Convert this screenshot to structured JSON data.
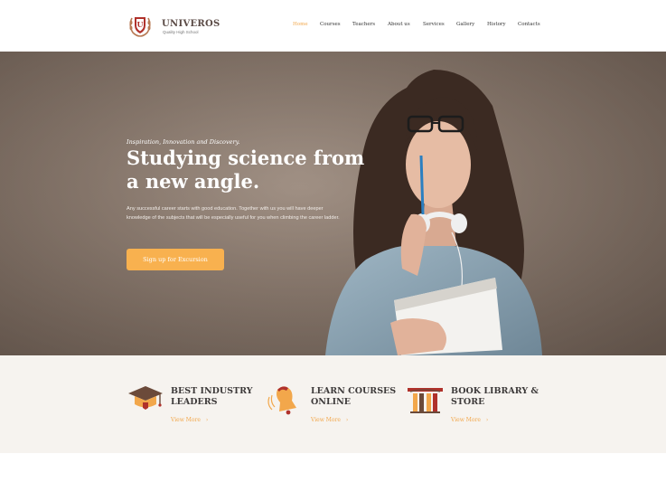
{
  "brand": {
    "name": "UNIVEROS",
    "tagline": "Quality High School"
  },
  "nav": {
    "items": [
      {
        "label": "Home",
        "active": true
      },
      {
        "label": "Courses",
        "active": false
      },
      {
        "label": "Teachers",
        "active": false
      },
      {
        "label": "About us",
        "active": false
      },
      {
        "label": "Services",
        "active": false
      },
      {
        "label": "Gallery",
        "active": false
      },
      {
        "label": "History",
        "active": false
      },
      {
        "label": "Contacts",
        "active": false
      }
    ]
  },
  "hero": {
    "kicker": "Inspiration, Innovation and Discovery.",
    "title": "Studying science from a new angle.",
    "text": "Any successful career starts with good education. Together with us you will have deeper knowledge of the subjects that will be especially useful for you when climbing the career ladder.",
    "button": "Sign up for Excursion"
  },
  "features": [
    {
      "title": "Best Industry Leaders",
      "more": "View More",
      "icon": "graduation-cap-icon"
    },
    {
      "title": "Learn Courses Online",
      "more": "View More",
      "icon": "bell-icon"
    },
    {
      "title": "Book Library & Store",
      "more": "View More",
      "icon": "books-icon"
    }
  ],
  "colors": {
    "accent": "#f2a74b",
    "button": "#f8b14f",
    "logo": "#b0312b",
    "hero_bg": "#8a796d",
    "features_bg": "#f6f3ef"
  }
}
